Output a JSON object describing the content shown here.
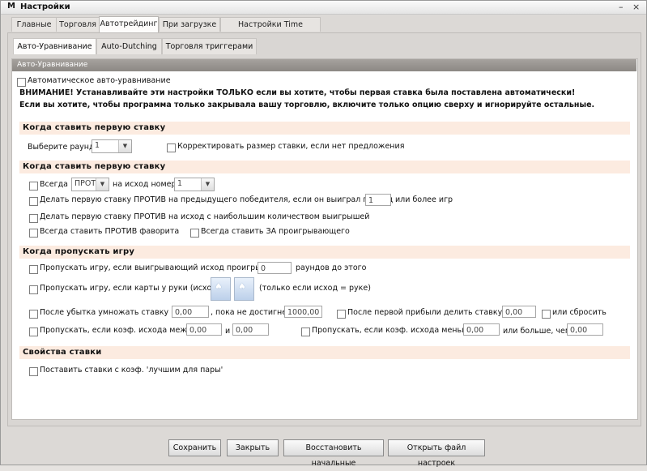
{
  "window": {
    "title": "Настройки",
    "logo": "M",
    "minimize": "–",
    "close": "×"
  },
  "main_tabs": [
    "Главные",
    "Торговля",
    "Автотрейдинг",
    "При загрузке",
    "Настройки Time Machine"
  ],
  "sub_tabs": [
    "Авто-Уравнивание",
    "Auto-Dutching",
    "Торговля триггерами"
  ],
  "panel": {
    "header": "Авто-Уравнивание",
    "auto_level_label": "Автоматическое авто-уравнивание",
    "warning_line1": "ВНИМАНИЕ! Устанавливайте эти настройки ТОЛЬКО если вы хотите, чтобы первая ставка была поставлена автоматически!",
    "warning_line2": "Если вы хотите, чтобы программа только закрывала вашу торговлю, включите только опцию сверху и игнорируйте остальные."
  },
  "section1": {
    "title": "Когда ставить первую ставку",
    "round_label": "Выберите раунд",
    "round_value": "1",
    "adjust_label": "Корректировать размер ставки, если нет предложения"
  },
  "section2": {
    "title": "Когда ставить первую ставку",
    "always_label": "Всегда",
    "against_value": "ПРОТ",
    "outcome_label": "на исход номер",
    "outcome_value": "1",
    "prev_winner_label": "Делать первую ставку ПРОТИВ на предыдущего победителя, если он выиграл подряд",
    "prev_winner_value": "1",
    "prev_winner_suffix": "или более игр",
    "most_wins_label": "Делать первую ставку ПРОТИВ на исход с наибольшим количеством выигрышей",
    "against_fav_label": "Всегда ставить ПРОТИВ фаворита",
    "for_loser_label": "Всегда ставить ЗА проигрывающего"
  },
  "section3": {
    "title": "Когда пропускать игру",
    "skip_lost_label": "Пропускать игру, если выигрывающий исход проигрывал",
    "skip_lost_value": "0",
    "skip_lost_suffix": "раундов до этого",
    "skip_cards_label": "Пропускать игру, если карты у руки (исхода)",
    "skip_cards_note": "(только если исход = руке)",
    "mult_label": "После убытка умножать ставку на",
    "mult_value": "0,00",
    "until_label": ", пока не достигнет",
    "until_value": "1000,00",
    "divide_label": "После первой прибыли делить ставку на",
    "divide_value": "0,00",
    "reset_label": "или сбросить",
    "skip_coef_label": "Пропускать, если коэф. исхода между",
    "skip_coef_from": "0,00",
    "skip_coef_and": "и",
    "skip_coef_to": "0,00",
    "skip_less_label": "Пропускать, если коэф. исхода меньше",
    "skip_less_value": "0,00",
    "more_than_label": "или больше, чем",
    "more_than_value": "0,00"
  },
  "section4": {
    "title": "Свойства ставки",
    "best_pair_label": "Поставить ставки с коэф. 'лучшим для пары'"
  },
  "buttons": {
    "save": "Сохранить",
    "close": "Закрыть",
    "restore": "Восстановить начальные",
    "open_file": "Открыть файл настроек"
  }
}
